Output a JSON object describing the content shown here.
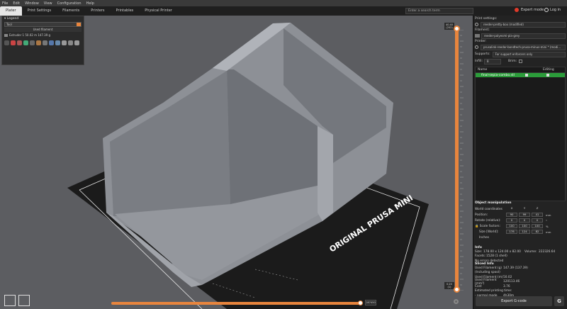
{
  "menu": [
    "File",
    "Edit",
    "Window",
    "View",
    "Configuration",
    "Help"
  ],
  "tabs": [
    {
      "label": "Plater",
      "active": true
    },
    {
      "label": "Print Settings",
      "active": false
    },
    {
      "label": "Filaments",
      "active": false
    },
    {
      "label": "Printers",
      "active": false
    },
    {
      "label": "Printables",
      "active": false
    },
    {
      "label": "Physical Printer",
      "active": false
    }
  ],
  "search": {
    "placeholder": "Enter a search term"
  },
  "mode": {
    "label": "Expert mode"
  },
  "login": {
    "label": "Log in"
  },
  "legend": {
    "title": "Legend",
    "view_type": "Tool",
    "sub_header": "Used filament",
    "extruder_line": "Extruder 1   50.02 m   147.39 g"
  },
  "bed": {
    "label": "ORIGINAL PRUSA MINI"
  },
  "vertical_slider": {
    "top_label_1": "40.40",
    "top_label_2": "(202)",
    "bottom_label_1": "0.20",
    "bottom_label_2": "(1)"
  },
  "horizontal_slider": {
    "label": "287450"
  },
  "panel": {
    "print_settings_label": "Print settings:",
    "print_settings_value": "reeder-pretty-box (modified)",
    "filament_label": "Filament:",
    "filament_value": "reeder-polyesmi-pla-grey",
    "printer_label": "Printer:",
    "printer_value": "prusalink-reeder-bondtech-prusa-minus-mini * (modi...",
    "supports_label": "Supports:",
    "supports_value": "For support enforcers only",
    "infill_label": "Infill:",
    "infill_value": "8",
    "brim_label": "Brim:",
    "list_headers": {
      "name": "Name",
      "editing": "Editing"
    },
    "list_item": "final-sepia-combo.stl"
  },
  "object_manipulation": {
    "title": "Object manipulation",
    "world_coordinates": "World coordinates",
    "axes": [
      "X",
      "Y",
      "Z"
    ],
    "position_label": "Position:",
    "position": [
      "90",
      "99",
      "41"
    ],
    "position_unit": "mm",
    "rotate_label": "Rotate (relative):",
    "rotate": [
      "0",
      "0",
      "0"
    ],
    "rotate_unit": "°",
    "scale_label": "Scale factors:",
    "scale": [
      "100",
      "100",
      "100"
    ],
    "scale_unit": "%",
    "size_label": "Size [World]:",
    "size": [
      "178",
      "124",
      "82"
    ],
    "size_unit": "mm",
    "inches_label": "Inches"
  },
  "info": {
    "title": "Info",
    "size_label": "Size:",
    "size_value": "178.00 x 124.00 x 82.00",
    "volume_label": "Volume:",
    "volume_value": "222326.64",
    "facets_label": "Facets:",
    "facets_value": "1528 (1 shell)",
    "errors": "No errors detected"
  },
  "sliced_info": {
    "title": "Sliced Info",
    "rows": [
      {
        "k": "Used Filament (g)",
        "v": "147.39 (137.39)"
      },
      {
        "k": "   (Including spool)",
        "v": ""
      },
      {
        "k": "Used Filament (m)",
        "v": "50.02"
      },
      {
        "k": "Used Filament (mm³)",
        "v": "120113.46"
      },
      {
        "k": "Cost",
        "v": "3.76"
      },
      {
        "k": "Estimated printing time:",
        "v": ""
      },
      {
        "k": "   - normal mode",
        "v": "4h30m"
      }
    ]
  },
  "export_button": {
    "label": "Export G-code"
  },
  "gcode_icon": {
    "label": "G"
  },
  "colors": {
    "accent": "#e8853d",
    "bed": "#1b1b1b",
    "model": "#8d9096",
    "selected_row": "#2b9c3a"
  }
}
